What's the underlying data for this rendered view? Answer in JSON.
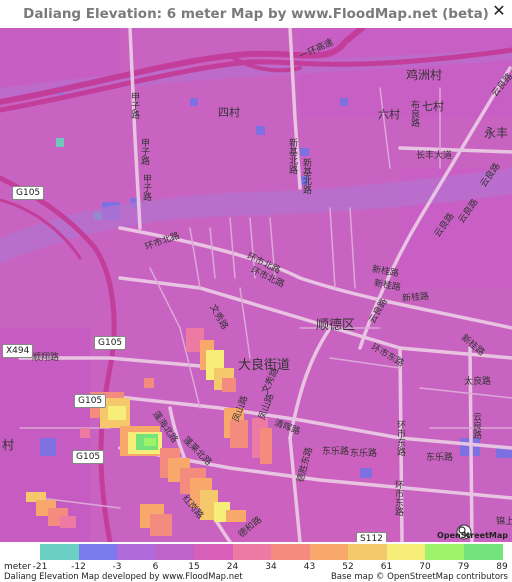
{
  "title": "Daliang Elevation: 6 meter Map by www.FloodMap.net (beta)",
  "close_icon": "close-icon",
  "map": {
    "place_labels": [
      {
        "id": "p1",
        "text": "鸡洲村",
        "size": 12
      },
      {
        "id": "p2",
        "text": "四村",
        "size": 11
      },
      {
        "id": "p3",
        "text": "六村",
        "size": 11
      },
      {
        "id": "p4",
        "text": "七村",
        "size": 11
      },
      {
        "id": "p5",
        "text": "永丰",
        "size": 12
      },
      {
        "id": "p6",
        "text": "顺德区",
        "size": 13
      },
      {
        "id": "p7",
        "text": "大良街道",
        "size": 13
      },
      {
        "id": "p8",
        "text": "村",
        "size": 12
      }
    ],
    "road_labels": [
      {
        "id": "r1",
        "text": "一环高速"
      },
      {
        "id": "r2",
        "text": "新基北路"
      },
      {
        "id": "r3",
        "text": "新基北路"
      },
      {
        "id": "r4",
        "text": "甲子路"
      },
      {
        "id": "r5",
        "text": "甲子路"
      },
      {
        "id": "r6",
        "text": "环市北路"
      },
      {
        "id": "r7",
        "text": "环市北路"
      },
      {
        "id": "r8",
        "text": "新桂路"
      },
      {
        "id": "r9",
        "text": "新桂路"
      },
      {
        "id": "r10",
        "text": "新桂路"
      },
      {
        "id": "r11",
        "text": "长丰大道"
      },
      {
        "id": "r12",
        "text": "云良路"
      },
      {
        "id": "r13",
        "text": "云良路"
      },
      {
        "id": "r14",
        "text": "云良路"
      },
      {
        "id": "r15",
        "text": "布良路"
      },
      {
        "id": "r16",
        "text": "云良路"
      },
      {
        "id": "r17",
        "text": "文秀路"
      },
      {
        "id": "r18",
        "text": "文秀路"
      },
      {
        "id": "r19",
        "text": "凤山路"
      },
      {
        "id": "r20",
        "text": "凤山路"
      },
      {
        "id": "r21",
        "text": "清晖路"
      },
      {
        "id": "r22",
        "text": "东乐路"
      },
      {
        "id": "r23",
        "text": "东乐路"
      },
      {
        "id": "r24",
        "text": "东乐路"
      },
      {
        "id": "r25",
        "text": "环市东路"
      },
      {
        "id": "r26",
        "text": "环市东路"
      },
      {
        "id": "r27",
        "text": "太良路"
      },
      {
        "id": "r28",
        "text": "顺翔路"
      },
      {
        "id": "r29",
        "text": "蓬海北路"
      },
      {
        "id": "r30",
        "text": "蓬莱北路"
      },
      {
        "id": "r31",
        "text": "红岗路"
      },
      {
        "id": "r32",
        "text": "德胜东路"
      },
      {
        "id": "r33",
        "text": "德和路"
      },
      {
        "id": "r34",
        "text": "锦上"
      },
      {
        "id": "r35",
        "text": "云良路"
      },
      {
        "id": "r36",
        "text": "新桂路"
      },
      {
        "id": "r37",
        "text": "甲子路"
      },
      {
        "id": "r38",
        "text": "环市北路"
      },
      {
        "id": "r39",
        "text": "云良路"
      },
      {
        "id": "r40",
        "text": "环市东路"
      }
    ],
    "shields": [
      {
        "id": "s1",
        "text": "G105"
      },
      {
        "id": "s2",
        "text": "G105"
      },
      {
        "id": "s3",
        "text": "G105"
      },
      {
        "id": "s4",
        "text": "G105"
      },
      {
        "id": "s5",
        "text": "X494"
      },
      {
        "id": "s6",
        "text": "S112"
      }
    ],
    "osm_badge": "OpenStreetMap"
  },
  "legend": {
    "unit": "meter",
    "ticks": [
      "-21",
      "-12",
      "-3",
      "6",
      "15",
      "24",
      "34",
      "43",
      "52",
      "61",
      "70",
      "79",
      "89"
    ],
    "colors": [
      "#6ccfc4",
      "#7b7bee",
      "#b06ad9",
      "#c063c9",
      "#d75fb9",
      "#ec7aa2",
      "#f38b7e",
      "#f9a86c",
      "#f6c86c",
      "#f6ee78",
      "#9ff36b",
      "#74e37b"
    ],
    "credit_left": "Daliang Elevation Map developed by www.FloodMap.net",
    "credit_right": "Base map © OpenStreetMap contributors"
  }
}
